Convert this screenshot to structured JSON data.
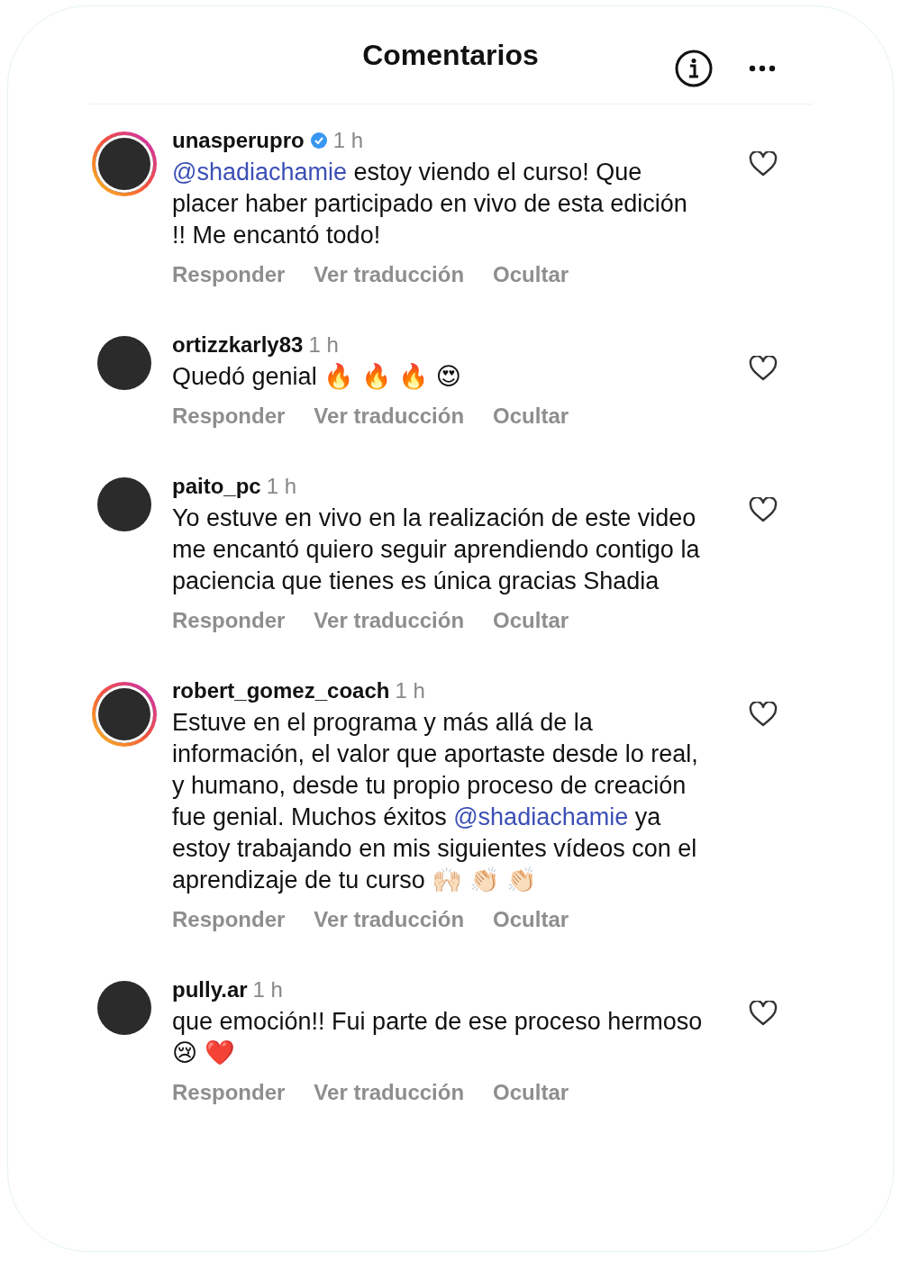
{
  "header": {
    "title": "Comentarios"
  },
  "comments": [
    {
      "username": "unasperupro",
      "verified": true,
      "story_ring": true,
      "time": "1 h",
      "body": [
        {
          "kind": "mention",
          "text": "@shadiachamie"
        },
        {
          "kind": "text",
          "text": " estoy viendo el curso! Que placer haber participado en vivo de esta edición !! Me encantó todo!"
        }
      ],
      "actions": [
        "Responder",
        "Ver traducción",
        "Ocultar"
      ],
      "liked": false
    },
    {
      "username": "ortizzkarly83",
      "verified": false,
      "story_ring": false,
      "time": "1 h",
      "body": [
        {
          "kind": "text",
          "text": "Quedó genial 🔥 🔥 🔥 😍"
        }
      ],
      "actions": [
        "Responder",
        "Ver traducción",
        "Ocultar"
      ],
      "liked": false
    },
    {
      "username": "paito_pc",
      "verified": false,
      "story_ring": false,
      "time": "1 h",
      "body": [
        {
          "kind": "text",
          "text": "Yo estuve en vivo en la realización de este video me encantó quiero seguir aprendiendo contigo la paciencia que tienes es única gracias Shadia"
        }
      ],
      "actions": [
        "Responder",
        "Ver traducción",
        "Ocultar"
      ],
      "liked": false
    },
    {
      "username": "robert_gomez_coach",
      "verified": false,
      "story_ring": true,
      "time": "1 h",
      "body": [
        {
          "kind": "text",
          "text": "Estuve en el programa y más allá de la información, el valor que aportaste desde lo real, y humano, desde tu propio proceso de creación fue genial. Muchos éxitos "
        },
        {
          "kind": "mention",
          "text": "@shadiachamie"
        },
        {
          "kind": "text",
          "text": " ya estoy trabajando en mis siguientes vídeos con el aprendizaje de tu curso 🙌🏻 👏🏻 👏🏻"
        }
      ],
      "actions": [
        "Responder",
        "Ver traducción",
        "Ocultar"
      ],
      "liked": false
    },
    {
      "username": "pully.ar",
      "verified": false,
      "story_ring": false,
      "time": "1 h",
      "body": [
        {
          "kind": "text",
          "text": "que emoción!! Fui parte de ese proceso hermoso 😢 ❤️"
        }
      ],
      "actions": [
        "Responder",
        "Ver traducción",
        "Ocultar"
      ],
      "liked": false
    }
  ]
}
